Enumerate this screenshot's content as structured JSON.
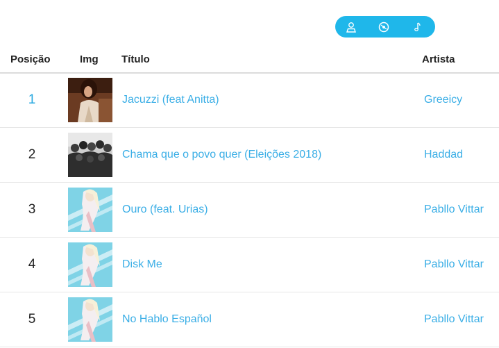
{
  "colors": {
    "accent": "#1fb7ea",
    "link": "#3aaee6"
  },
  "view_toggle": {
    "icons": [
      "user-icon",
      "disc-icon",
      "music-note-icon"
    ]
  },
  "header": {
    "position": "Posição",
    "img": "Img",
    "title": "Título",
    "artist": "Artista"
  },
  "rows": [
    {
      "position": "1",
      "title": "Jacuzzi (feat Anitta)",
      "artist": "Greeicy",
      "cover": "greeicy-cover"
    },
    {
      "position": "2",
      "title": "Chama que o povo quer (Eleições 2018)",
      "artist": "Haddad",
      "cover": "haddad-cover"
    },
    {
      "position": "3",
      "title": "Ouro (feat. Urias)",
      "artist": "Pabllo Vittar",
      "cover": "pabllo-cover"
    },
    {
      "position": "4",
      "title": "Disk Me",
      "artist": "Pabllo Vittar",
      "cover": "pabllo-cover"
    },
    {
      "position": "5",
      "title": "No Hablo Español",
      "artist": "Pabllo Vittar",
      "cover": "pabllo-cover"
    }
  ]
}
